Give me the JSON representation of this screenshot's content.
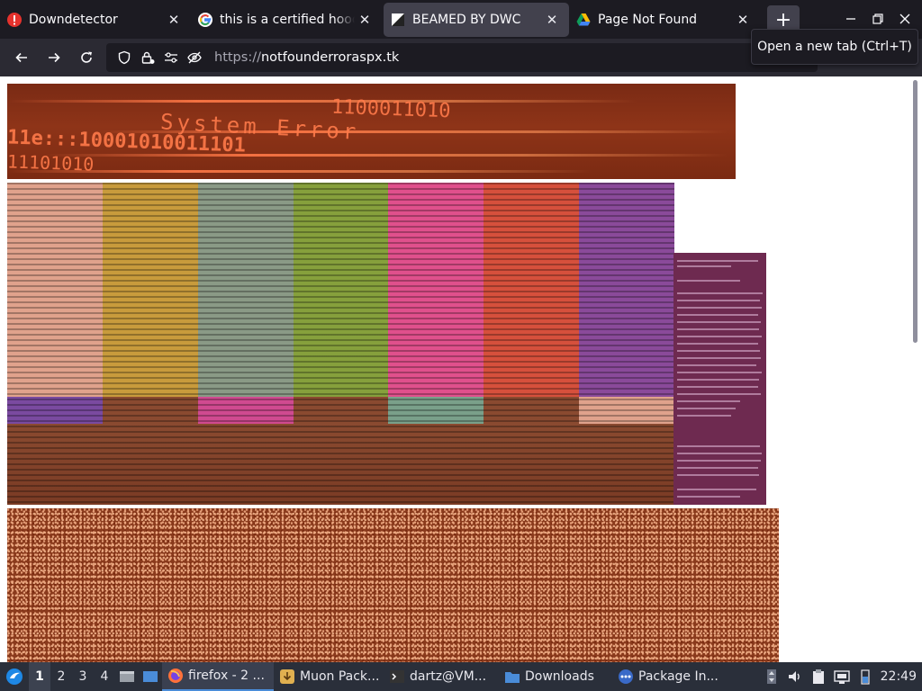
{
  "browser": {
    "tabs": [
      {
        "title": "Downdetector",
        "favicon": "downdetector-icon",
        "active": false
      },
      {
        "title": "this is a certified hood",
        "favicon": "google-icon",
        "active": false
      },
      {
        "title": "BEAMED BY DWC",
        "favicon": "page-icon",
        "active": true
      },
      {
        "title": "Page Not Found",
        "favicon": "google-drive-icon",
        "active": false
      }
    ],
    "new_tab_tooltip": "Open a new tab (Ctrl+T)",
    "url_scheme": "https://",
    "url_host": "notfounderroraspx.tk"
  },
  "content": {
    "banner_text_1": "1100011010",
    "banner_text_2": "System Error",
    "banner_text_3": "11e:::10001010011101",
    "banner_text_4": "11101010"
  },
  "taskbar": {
    "workspaces": [
      "1",
      "2",
      "3",
      "4"
    ],
    "active_workspace": "1",
    "tasks": [
      {
        "label": "firefox - 2 ...",
        "icon": "firefox-icon",
        "active": true
      },
      {
        "label": "Muon Pack...",
        "icon": "package-icon",
        "active": false
      },
      {
        "label": "dartz@VM...",
        "icon": "terminal-icon",
        "active": false
      },
      {
        "label": "Downloads",
        "icon": "folder-icon",
        "active": false
      },
      {
        "label": "Package In...",
        "icon": "package-installer-icon",
        "active": false
      }
    ],
    "clock": "22:49"
  },
  "colors": {
    "tabbar_bg": "#1c1b22",
    "navbar_bg": "#2b2a33",
    "active_tab_bg": "#42414d",
    "taskbar_bg": "#2a2f3a"
  }
}
